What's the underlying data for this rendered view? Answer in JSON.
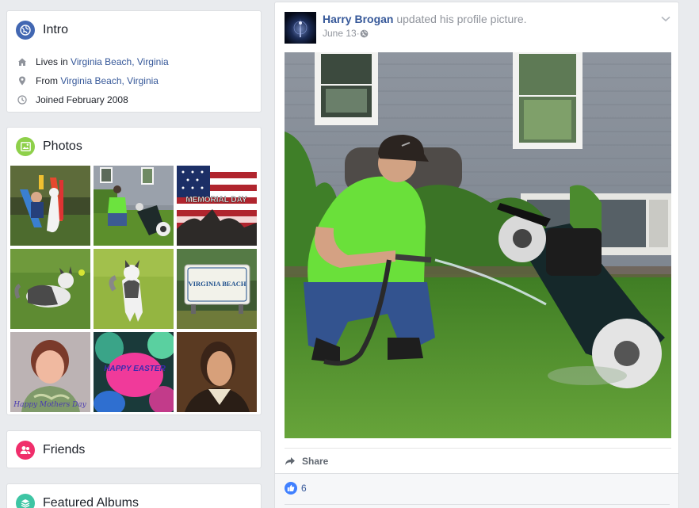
{
  "intro": {
    "title": "Intro",
    "icon": "globe-icon",
    "rows": [
      {
        "icon": "house-icon",
        "prefix": "Lives in ",
        "link": "Virginia Beach, Virginia"
      },
      {
        "icon": "location-pin-icon",
        "prefix": "From ",
        "link": "Virginia Beach, Virginia"
      },
      {
        "icon": "clock-icon",
        "prefix": "Joined February 2008",
        "link": ""
      }
    ]
  },
  "photos": {
    "title": "Photos",
    "icon": "photo-icon",
    "items": [
      {
        "name": "child-on-slide",
        "text": ""
      },
      {
        "name": "man-mowing-lawn",
        "text": ""
      },
      {
        "name": "memorial-day-flag",
        "text": "MEMORIAL DAY"
      },
      {
        "name": "husky-playing-ball",
        "text": ""
      },
      {
        "name": "husky-standing",
        "text": ""
      },
      {
        "name": "virginia-beach-sign",
        "text": "VIRGINIA BEACH"
      },
      {
        "name": "woman-portrait",
        "text": "Happy Mothers Day"
      },
      {
        "name": "happy-easter-egg",
        "text": "HAPPY EASTER"
      },
      {
        "name": "painted-portrait",
        "text": ""
      }
    ]
  },
  "friends": {
    "title": "Friends",
    "icon": "friends-icon"
  },
  "albums": {
    "title": "Featured Albums",
    "icon": "albums-icon"
  },
  "post": {
    "author": "Harry Brogan",
    "action": " updated his profile picture.",
    "date": "June 13",
    "separator": " · ",
    "privacy_icon": "globe-small-icon",
    "menu_icon": "chevron-down-icon",
    "share_label": "Share",
    "like_count": "6"
  },
  "colors": {
    "link": "#365899",
    "background": "#e9ebee",
    "intro_icon": "#4267b2",
    "photos_icon": "#8ed04a",
    "friends_icon": "#f02e6b",
    "albums_icon": "#3ec5a4",
    "like": "#4080ff"
  }
}
